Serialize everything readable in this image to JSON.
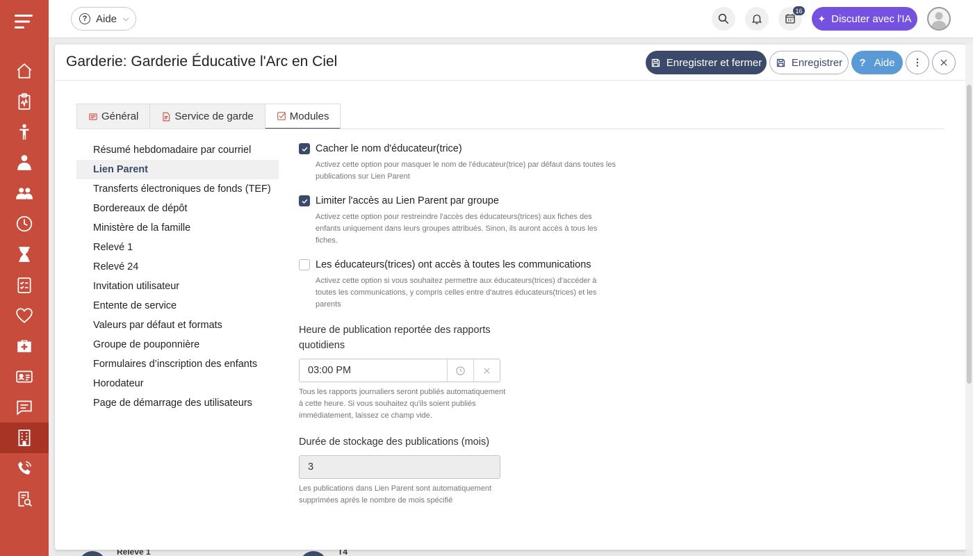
{
  "topbar": {
    "help_label": "Aide",
    "notification_count": "16",
    "ai_button_label": "Discuter avec l'IA"
  },
  "sidebar": {
    "items": [
      {
        "icon": "home-icon"
      },
      {
        "icon": "clipboard-chart-icon"
      },
      {
        "icon": "child-icon"
      },
      {
        "icon": "educator-icon"
      },
      {
        "icon": "group-icon"
      },
      {
        "icon": "clock-icon"
      },
      {
        "icon": "hourglass-icon"
      },
      {
        "icon": "checklist-icon"
      },
      {
        "icon": "heart-icon"
      },
      {
        "icon": "medical-kit-icon"
      },
      {
        "icon": "id-card-icon"
      },
      {
        "icon": "chat-icon"
      },
      {
        "icon": "building-icon",
        "active": true
      },
      {
        "icon": "phone-icon"
      },
      {
        "icon": "report-search-icon"
      }
    ]
  },
  "modal": {
    "title": "Garderie: Garderie Éducative l'Arc en Ciel",
    "save_close_label": "Enregistrer et fermer",
    "save_label": "Enregistrer",
    "help_label": "Aide"
  },
  "tabs": [
    {
      "label": "Général"
    },
    {
      "label": "Service de garde"
    },
    {
      "label": "Modules",
      "active": true
    }
  ],
  "menu": [
    "Résumé hebdomadaire par courriel",
    "Lien Parent",
    "Transferts électroniques de fonds (TEF)",
    "Bordereaux de dépôt",
    "Ministère de la famille",
    "Relevé 1",
    "Relevé 24",
    "Invitation utilisateur",
    "Entente de service",
    "Valeurs par défaut et formats",
    "Groupe de pouponnière",
    "Formulaires d’inscription des enfants",
    "Horodateur",
    "Page de démarrage des utilisateurs"
  ],
  "menu_active": "Lien Parent",
  "form": {
    "checkboxes": [
      {
        "label": "Cacher le nom d'éducateur(trice)",
        "description": "Activez cette option pour masquer le nom de l'éducateur(trice) par défaut dans toutes les publications sur Lien Parent",
        "checked": true
      },
      {
        "label": "Limiter l'accès au Lien Parent par groupe",
        "description": "Activez cette option pour restreindre l'accès des éducateurs(trices) aux fiches des enfants uniquement dans leurs groupes attribués. Sinon, ils auront accès à tous les fiches.",
        "checked": true
      },
      {
        "label": "Les éducateurs(trices) ont accès à toutes les communications",
        "description": "Activez cette option si vous souhaitez permettre aux éducateurs(trices) d'accéder à toutes les communications, y compris celles entre d'autres éducateurs(trices) et les parents",
        "checked": false
      }
    ],
    "publish_time_label": "Heure de publication reportée des rapports quotidiens",
    "publish_time_value": "03:00 PM",
    "publish_time_helper": "Tous les rapports journaliers seront publiés automatiquement à cette heure. Si vous souhaitez qu'ils soient publiés immédiatement, laissez ce champ vide.",
    "storage_label": "Durée de stockage des publications (mois)",
    "storage_value": "3",
    "storage_helper": "Les publications dans Lien Parent sont automatiquement supprimées après le nombre de mois spécifié"
  },
  "background_peek": {
    "item1": "Relevé 1",
    "item2": "T4"
  },
  "colors": {
    "sidebar": "#c84c3c",
    "sidebar_active": "#a83426",
    "primary_dark": "#3b4a6b",
    "help_blue": "#5b9bd5",
    "ai_purple": "#7551e0"
  }
}
